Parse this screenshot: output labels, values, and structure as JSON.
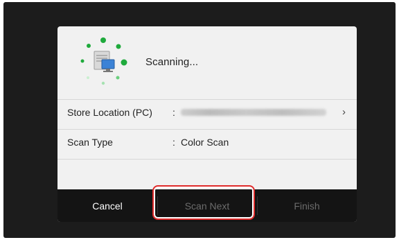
{
  "dialog": {
    "status_text": "Scanning...",
    "animation_icon": "scanning-animation-icon",
    "rows": [
      {
        "label": "Store Location (PC)",
        "colon": ":",
        "value": "",
        "value_redacted": true,
        "chevron": "›"
      },
      {
        "label": "Scan Type",
        "colon": ":",
        "value": "Color Scan"
      }
    ],
    "buttons": {
      "cancel": "Cancel",
      "scan_next": "Scan Next",
      "finish": "Finish"
    }
  },
  "colors": {
    "screen_bg": "#1c1c1c",
    "dialog_bg": "#f1f1f1",
    "button_bar_bg": "#141414",
    "dot_green": "#1faa3c",
    "highlight_red": "#e02a2a",
    "disabled_text": "#6c6c6c"
  }
}
